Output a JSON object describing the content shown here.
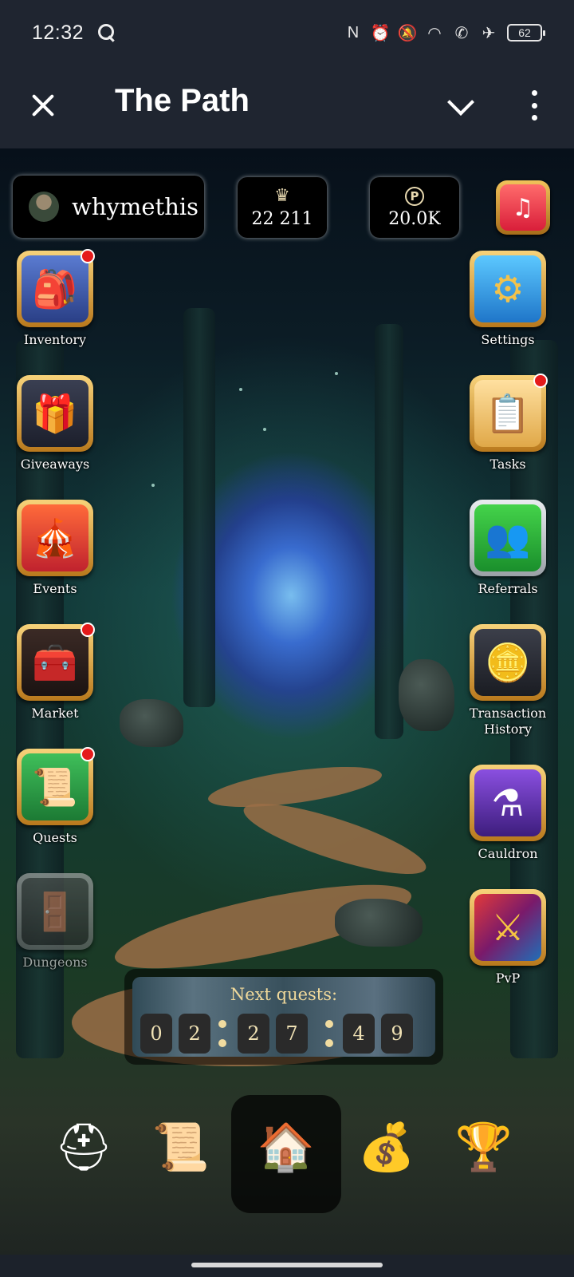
{
  "status_bar": {
    "time": "12:32",
    "battery": "62",
    "icons": [
      "nfc-icon",
      "alarm-icon",
      "mute-icon",
      "wifi-icon",
      "wifi-calling-icon",
      "airplane-icon"
    ]
  },
  "app_bar": {
    "title": "The Path"
  },
  "hud": {
    "username": "whymethis",
    "crown_value": "22 211",
    "coin_value": "20.0K",
    "coin_symbol": "P"
  },
  "left_menu": [
    {
      "label": "Inventory",
      "icon": "backpack-icon",
      "badge": true,
      "glyph": "🎒"
    },
    {
      "label": "Giveaways",
      "icon": "gift-icon",
      "badge": false,
      "glyph": "🎁"
    },
    {
      "label": "Events",
      "icon": "banner-icon",
      "badge": false,
      "glyph": "🎪"
    },
    {
      "label": "Market",
      "icon": "chest-icon",
      "badge": true,
      "glyph": "🧰"
    },
    {
      "label": "Quests",
      "icon": "scroll-icon",
      "badge": true,
      "glyph": "📜"
    },
    {
      "label": "Dungeons",
      "icon": "dungeon-door-icon",
      "badge": false,
      "glyph": "🚪"
    }
  ],
  "right_menu": [
    {
      "label": "Settings",
      "icon": "gear-icon",
      "badge": false,
      "glyph": "⚙"
    },
    {
      "label": "Tasks",
      "icon": "checklist-icon",
      "badge": true,
      "glyph": "📋"
    },
    {
      "label": "Referrals",
      "icon": "referral-friends-icon",
      "badge": false,
      "glyph": "👥"
    },
    {
      "label": "Transaction History",
      "icon": "coins-stack-icon",
      "badge": false,
      "glyph": "🪙"
    },
    {
      "label": "Cauldron",
      "icon": "cauldron-icon",
      "badge": false,
      "glyph": "⚗"
    },
    {
      "label": "PvP",
      "icon": "crossed-swords-icon",
      "badge": false,
      "glyph": "⚔"
    }
  ],
  "timer": {
    "title": "Next quests:",
    "digits": [
      "0",
      "2",
      "2",
      "7",
      "4",
      "9"
    ]
  },
  "bottom_nav": [
    {
      "name": "nav-knight-helmet",
      "icon": "knight-helmet-icon",
      "glyph": "⛑"
    },
    {
      "name": "nav-quest-scroll",
      "icon": "alert-scroll-icon",
      "glyph": "📜"
    },
    {
      "name": "nav-home-house",
      "icon": "house-icon",
      "glyph": "🏠",
      "active": true
    },
    {
      "name": "nav-treasure-chest",
      "icon": "treasure-chest-icon",
      "glyph": "💰"
    },
    {
      "name": "nav-trophy",
      "icon": "trophy-icon",
      "glyph": "🏆"
    }
  ]
}
